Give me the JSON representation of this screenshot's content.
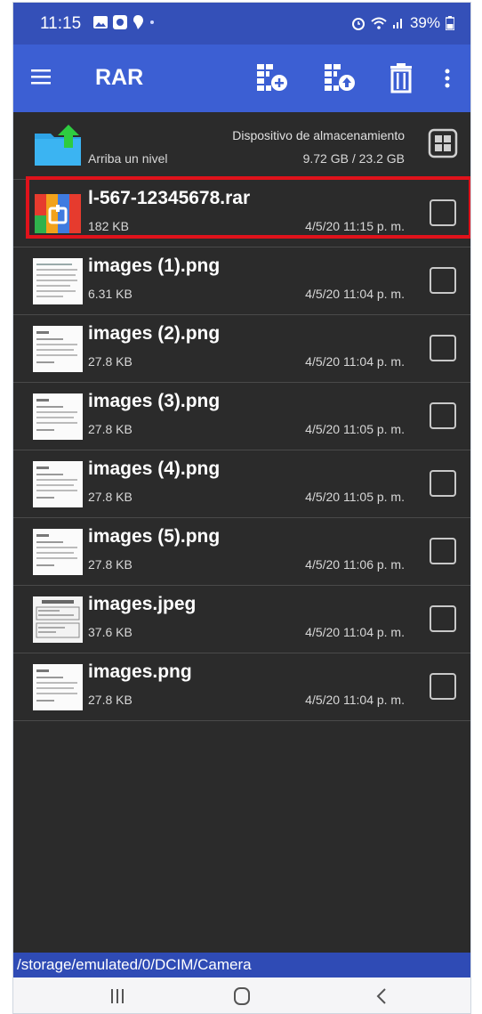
{
  "status_bar": {
    "time": "11:15",
    "battery": "39%",
    "left_icons": [
      "gallery-icon",
      "screen-icon",
      "chat-icon",
      "dot-icon"
    ],
    "right_icons": [
      "alarm-icon",
      "wifi-icon",
      "signal-icon",
      "battery-icon"
    ]
  },
  "toolbar": {
    "title": "RAR",
    "actions": [
      "add-to-archive-icon",
      "extract-icon",
      "delete-icon",
      "more-icon"
    ]
  },
  "up_row": {
    "label": "Arriba un nivel",
    "storage_label": "Dispositivo de almacenamiento",
    "storage_value": "9.72 GB / 23.2 GB"
  },
  "files": [
    {
      "name": "l-567-12345678.rar",
      "size": "182 KB",
      "date": "4/5/20 11:15 p. m.",
      "type": "rar"
    },
    {
      "name": "images (1).png",
      "size": "6.31 KB",
      "date": "4/5/20 11:04 p. m.",
      "type": "image"
    },
    {
      "name": "images (2).png",
      "size": "27.8 KB",
      "date": "4/5/20 11:04 p. m.",
      "type": "image"
    },
    {
      "name": "images (3).png",
      "size": "27.8 KB",
      "date": "4/5/20 11:05 p. m.",
      "type": "image"
    },
    {
      "name": "images (4).png",
      "size": "27.8 KB",
      "date": "4/5/20 11:05 p. m.",
      "type": "image"
    },
    {
      "name": "images (5).png",
      "size": "27.8 KB",
      "date": "4/5/20 11:06 p. m.",
      "type": "image"
    },
    {
      "name": "images.jpeg",
      "size": "37.6 KB",
      "date": "4/5/20 11:04 p. m.",
      "type": "image"
    },
    {
      "name": "images.png",
      "size": "27.8 KB",
      "date": "4/5/20 11:04 p. m.",
      "type": "image"
    }
  ],
  "path": "/storage/emulated/0/DCIM/Camera",
  "colors": {
    "status_bar": "#3450b8",
    "toolbar": "#3c5fd3",
    "background": "#2b2b2b",
    "highlight": "#e0121b"
  }
}
